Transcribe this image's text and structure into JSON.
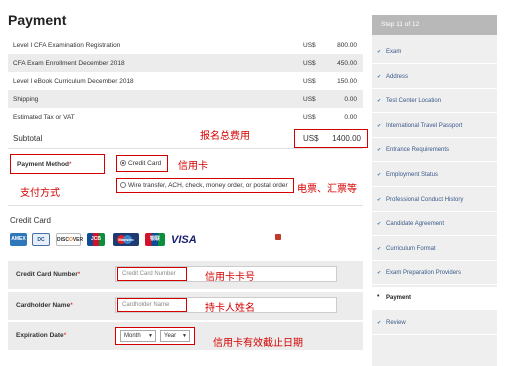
{
  "page": {
    "title": "Payment"
  },
  "fees": {
    "rows": [
      {
        "desc": "Level I CFA Examination Registration",
        "currency": "US$",
        "amount": "800.00"
      },
      {
        "desc": "CFA Exam Enrollment December 2018",
        "currency": "US$",
        "amount": "450.00"
      },
      {
        "desc": "Level I eBook Curriculum December 2018",
        "currency": "US$",
        "amount": "150.00"
      },
      {
        "desc": "Shipping",
        "currency": "US$",
        "amount": "0.00"
      },
      {
        "desc": "Estimated Tax or VAT",
        "currency": "US$",
        "amount": "0.00"
      }
    ],
    "subtotal": {
      "label": "Subtotal",
      "currency": "US$",
      "amount": "1400.00"
    }
  },
  "annotations": {
    "total_fee": "报名总费用",
    "credit_card": "信用卡",
    "payment_method": "支付方式",
    "telegraph": "电票、汇票等",
    "card_number": "信用卡卡号",
    "holder_name": "持卡人姓名",
    "expiry": "信用卡有效截止日期"
  },
  "payment_method": {
    "label": "Payment Method",
    "required_mark": "*",
    "options": [
      {
        "label": "Credit Card",
        "selected": true
      },
      {
        "label": "Wire transfer, ACH, check, money order, or postal order",
        "selected": false
      }
    ]
  },
  "credit_card": {
    "heading": "Credit Card",
    "brands": [
      "AMEX",
      "Diners",
      "DISCOVER",
      "JCB",
      "Maestro",
      "UnionPay",
      "VISA"
    ],
    "card_number": {
      "label": "Credit Card Number",
      "required_mark": "*",
      "placeholder": "Credit Card Number"
    },
    "holder_name": {
      "label": "Cardholder Name",
      "required_mark": "*",
      "placeholder": "Cardholder Name"
    },
    "expiration": {
      "label": "Expiration Date",
      "required_mark": "*",
      "month": "Month",
      "year": "Year"
    }
  },
  "sidebar": {
    "header": "Step 11 of 12",
    "steps": [
      {
        "label": "Exam",
        "icon": "check-icon",
        "current": false
      },
      {
        "label": "Address",
        "icon": "check-icon",
        "current": false
      },
      {
        "label": "Test Center Location",
        "icon": "check-icon",
        "current": false
      },
      {
        "label": "International Travel Passport",
        "icon": "check-icon",
        "current": false
      },
      {
        "label": "Entrance Requirements",
        "icon": "check-icon",
        "current": false
      },
      {
        "label": "Employment Status",
        "icon": "check-icon",
        "current": false
      },
      {
        "label": "Professional Conduct History",
        "icon": "check-icon",
        "current": false
      },
      {
        "label": "Candidate Agreement",
        "icon": "check-icon",
        "current": false
      },
      {
        "label": "Curriculum Format",
        "icon": "check-icon",
        "current": false
      },
      {
        "label": "Exam Preparation Providers",
        "icon": "check-icon",
        "current": false
      },
      {
        "label": "Payment",
        "icon": "bullet-icon",
        "current": true
      },
      {
        "label": "Review",
        "icon": "check-icon",
        "current": false
      }
    ]
  },
  "colors": {
    "annotation_red": "#d40000",
    "step_link": "#3a5a8a",
    "sidebar_header": "#b8b8b8"
  }
}
